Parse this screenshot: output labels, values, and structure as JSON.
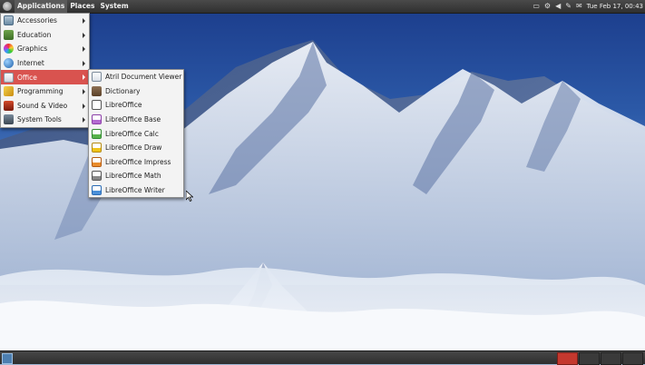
{
  "top_panel": {
    "menus": [
      "Applications",
      "Places",
      "System"
    ],
    "clock": "Tue Feb 17, 00:43"
  },
  "applications_menu": {
    "items": [
      {
        "label": "Accessories",
        "icon": "accessories-icon"
      },
      {
        "label": "Education",
        "icon": "education-icon"
      },
      {
        "label": "Graphics",
        "icon": "graphics-icon"
      },
      {
        "label": "Internet",
        "icon": "internet-icon"
      },
      {
        "label": "Office",
        "icon": "office-icon"
      },
      {
        "label": "Programming",
        "icon": "programming-icon"
      },
      {
        "label": "Sound & Video",
        "icon": "sound-video-icon"
      },
      {
        "label": "System Tools",
        "icon": "system-tools-icon"
      }
    ],
    "highlighted": "Office"
  },
  "office_menu": {
    "items": [
      {
        "label": "Atril Document Viewer",
        "icon": "document-viewer-icon"
      },
      {
        "label": "Dictionary",
        "icon": "dictionary-icon"
      },
      {
        "label": "LibreOffice",
        "icon": "libreoffice-icon"
      },
      {
        "label": "LibreOffice Base",
        "icon": "libreoffice-base-icon"
      },
      {
        "label": "LibreOffice Calc",
        "icon": "libreoffice-calc-icon"
      },
      {
        "label": "LibreOffice Draw",
        "icon": "libreoffice-draw-icon"
      },
      {
        "label": "LibreOffice Impress",
        "icon": "libreoffice-impress-icon"
      },
      {
        "label": "LibreOffice Math",
        "icon": "libreoffice-math-icon"
      },
      {
        "label": "LibreOffice Writer",
        "icon": "libreoffice-writer-icon"
      }
    ]
  },
  "colors": {
    "highlight": "#d9534f",
    "panel": "#3a3a3a",
    "active_workspace": "#c4382e"
  }
}
